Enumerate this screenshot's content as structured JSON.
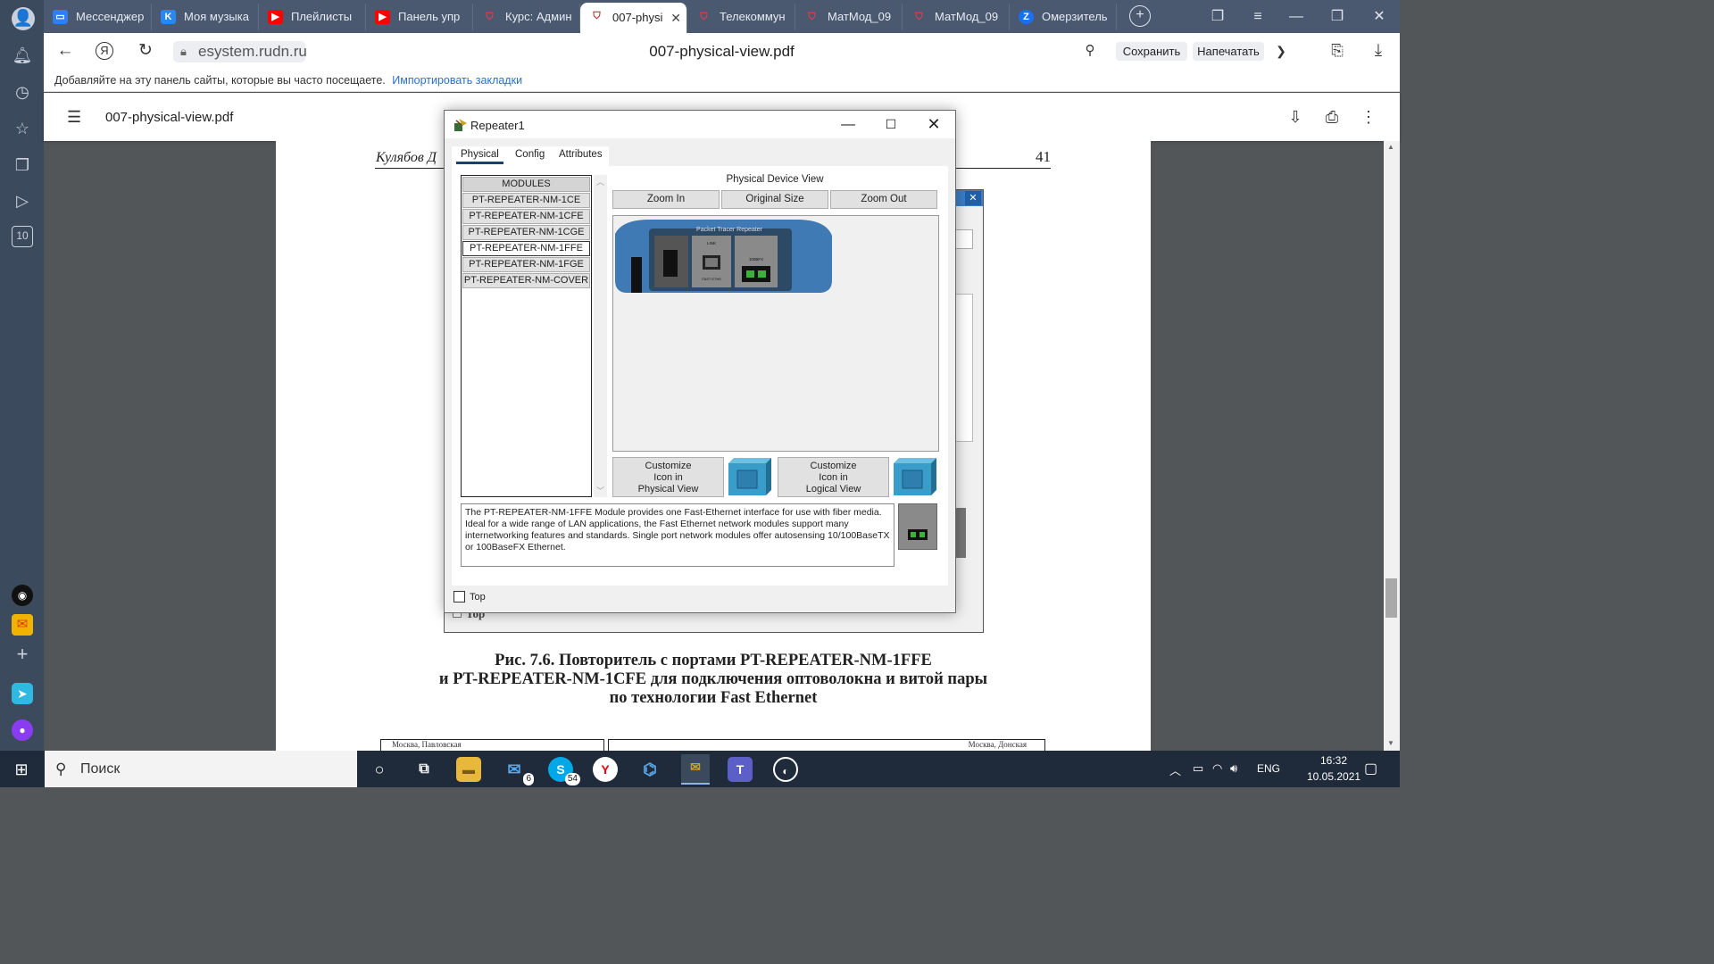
{
  "browser": {
    "tabs": [
      {
        "label": "Мессенджер",
        "icon": "messenger-icon",
        "color": "#2f7ef5"
      },
      {
        "label": "Моя музыка",
        "icon": "vk-icon",
        "color": "#2787f5"
      },
      {
        "label": "Плейлисты",
        "icon": "youtube-icon",
        "color": "#ff0000"
      },
      {
        "label": "Панель упр",
        "icon": "youtube-icon",
        "color": "#ff0000"
      },
      {
        "label": "Курс: Админ",
        "icon": "rudn-icon",
        "color": "#c8202f"
      },
      {
        "label": "007-physi",
        "icon": "rudn-icon",
        "color": "#c8202f"
      },
      {
        "label": "Телекоммун",
        "icon": "rudn-icon",
        "color": "#c8202f"
      },
      {
        "label": "МатМод_09",
        "icon": "rudn-icon",
        "color": "#c8202f"
      },
      {
        "label": "МатМод_09",
        "icon": "rudn-icon",
        "color": "#c8202f"
      },
      {
        "label": "Омерзитель",
        "icon": "z-icon",
        "color": "#1d6ff2"
      }
    ],
    "url": "esystem.rudn.ru",
    "page_title": "007-physical-view.pdf",
    "save_label": "Сохранить",
    "print_label": "Напечатать",
    "bookmarks_hint": "Добавляйте на эту панель сайты, которые вы часто посещаете.",
    "bookmarks_import": "Импортировать закладки",
    "sidebar_badge": "10"
  },
  "pdf": {
    "filename": "007-physical-view.pdf",
    "header_author": "Кулябов Д",
    "page_number": "41",
    "caption_line1": "Рис. 7.6. Повторитель с портами PT-REPEATER-NM-1FFE",
    "caption_line2": "и PT-REPEATER-NM-1CFE для подключения оптоволокна и витой пары",
    "caption_line3": "по технологии Fast Ethernet",
    "figure_checkbox_label": "Top",
    "table_left_header": "Москва, Павловская",
    "table_right_header": "Москва, Донская"
  },
  "dialog": {
    "title": "Repeater1",
    "tabs": [
      "Physical",
      "Config",
      "Attributes"
    ],
    "modules_header": "MODULES",
    "modules": [
      "PT-REPEATER-NM-1CE",
      "PT-REPEATER-NM-1CFE",
      "PT-REPEATER-NM-1CGE",
      "PT-REPEATER-NM-1FFE",
      "PT-REPEATER-NM-1FGE",
      "PT-REPEATER-NM-COVER"
    ],
    "selected_module": "PT-REPEATER-NM-1FFE",
    "view_label": "Physical Device View",
    "zoom_in": "Zoom In",
    "original_size": "Original Size",
    "zoom_out": "Zoom Out",
    "device_label": "Packet Tracer Repeater",
    "port_label_link": "LINK",
    "port_label_eth": "FAST ETH0",
    "port_label_fiber": "100BFX",
    "customize_physical": [
      "Customize",
      "Icon in",
      "Physical View"
    ],
    "customize_logical": [
      "Customize",
      "Icon in",
      "Logical View"
    ],
    "description": "The PT-REPEATER-NM-1FFE Module provides one Fast-Ethernet interface for use with fiber media. Ideal for a wide range of LAN applications, the Fast Ethernet network modules support many internetworking features and standards. Single port network modules offer autosensing 10/100BaseTX or 100BaseFX Ethernet.",
    "top_label": "Top"
  },
  "taskbar": {
    "search": "Поиск",
    "mail_badge": "6",
    "skype_badge": "54",
    "lang": "ENG",
    "time": "16:32",
    "date": "10.05.2021"
  }
}
